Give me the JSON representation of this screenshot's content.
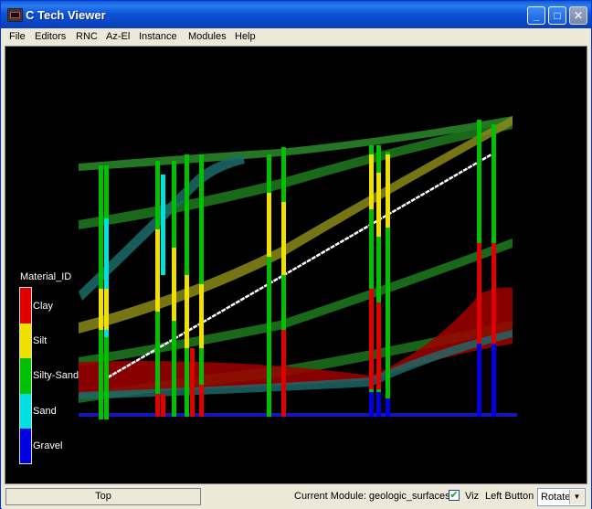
{
  "window": {
    "title": "C Tech Viewer",
    "minimize_icon": "minimize-icon",
    "maximize_icon": "maximize-icon",
    "close_icon": "close-icon"
  },
  "menu": [
    {
      "label": "File"
    },
    {
      "label": "Editors"
    },
    {
      "label": "RNC"
    },
    {
      "label": "Az-El"
    },
    {
      "label": "Instance"
    },
    {
      "label": "Modules"
    },
    {
      "label": "Help"
    }
  ],
  "legend": {
    "title": "Material_ID",
    "items": [
      {
        "label": "Clay",
        "color": "#e00000"
      },
      {
        "label": "Silt",
        "color": "#f0e000"
      },
      {
        "label": "Silty-Sand",
        "color": "#00c000"
      },
      {
        "label": "Sand",
        "color": "#00e0e0"
      },
      {
        "label": "Gravel",
        "color": "#0000e0"
      }
    ]
  },
  "status": {
    "top_button": "Top",
    "current_module": "Current Module: geologic_surfaces",
    "viz_label": "Viz",
    "viz_checked": true,
    "left_button_label": "Left Button",
    "mode_value": "Rotate"
  }
}
